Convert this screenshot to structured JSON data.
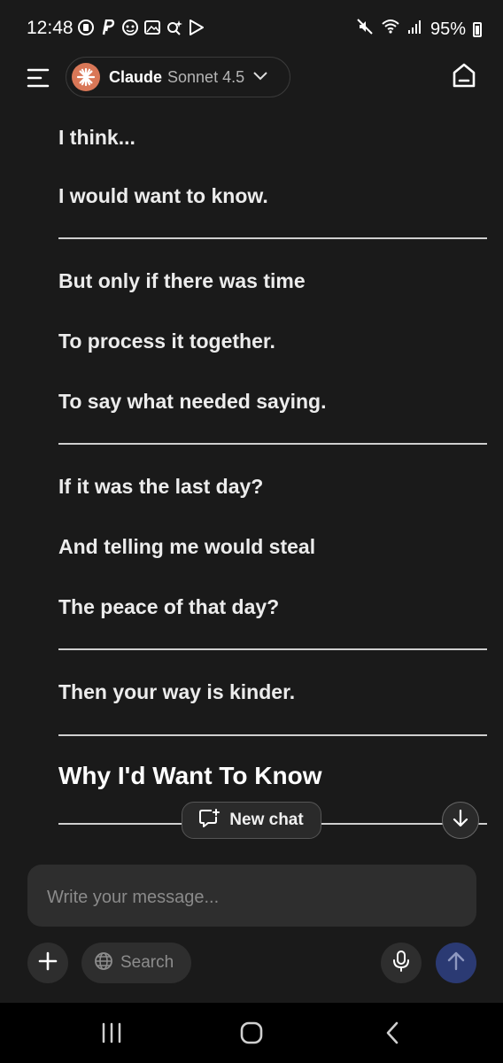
{
  "status_bar": {
    "time": "12:48",
    "battery": "95%"
  },
  "header": {
    "model_name": "Claude",
    "model_version": "Sonnet 4.5"
  },
  "conversation": {
    "lines": [
      "I think...",
      "I would want to know.",
      "But only if there was time",
      "To process it together.",
      "To say what needed saying.",
      "If it was the last day?",
      "And telling me would steal",
      "The peace of that day?",
      "Then your way is kinder."
    ],
    "heading": "Why I'd Want To Know"
  },
  "floating": {
    "new_chat_label": "New chat"
  },
  "composer": {
    "placeholder": "Write your message...",
    "search_label": "Search"
  },
  "colors": {
    "background": "#1a1a1a",
    "accent_logo": "#d97757",
    "send_button": "#2b3a73"
  }
}
